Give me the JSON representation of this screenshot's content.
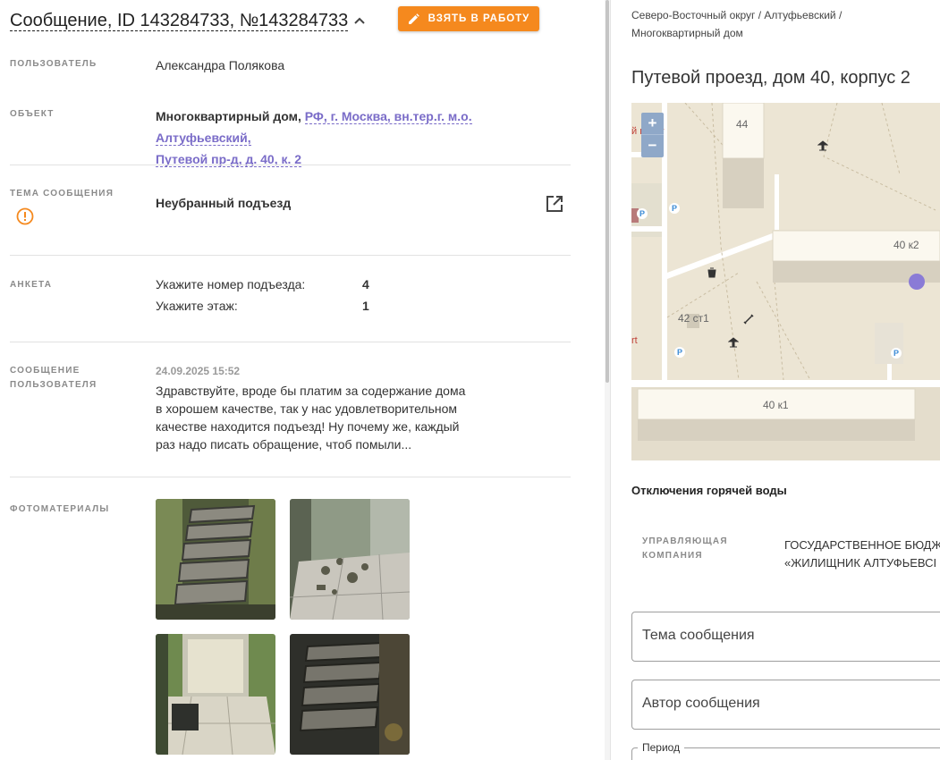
{
  "header": {
    "title": "Сообщение, ID 143284733, №143284733",
    "take_button": "ВЗЯТЬ В РАБОТУ"
  },
  "fields": {
    "user_label": "ПОЛЬЗОВАТЕЛЬ",
    "user_value": "Александра Полякова",
    "object_label": "ОБЪЕКТ",
    "object_type": "Многоквартирный дом,",
    "object_link_1": "РФ, г. Москва, вн.тер.г. м.о. Алтуфьевский,",
    "object_link_2": "Путевой пр-д, д. 40, к. 2",
    "topic_label": "ТЕМА СООБЩЕНИЯ",
    "topic_value": "Неубранный подъезд",
    "survey_label": "АНКЕТА",
    "survey": [
      {
        "question": "Укажите номер подъезда:",
        "answer": "4"
      },
      {
        "question": "Укажите этаж:",
        "answer": "1"
      }
    ],
    "message_label_1": "СООБЩЕНИЕ",
    "message_label_2": "ПОЛЬЗОВАТЕЛЯ",
    "message_date": "24.09.2025 15:52",
    "message_text": "Здравствуйте, вроде бы платим за содержание дома в хорошем качестве, так у нас удовлетворительном качестве находится подъезд! Ну почему же, каждый раз надо писать обращение, чтоб помыли...",
    "photos_label": "ФОТОМАТЕРИАЛЫ"
  },
  "right": {
    "breadcrumb": "Северо-Восточный округ / Алтуфьевский / Многоквартирный дом",
    "address": "Путевой проезд, дом 40, корпус 2",
    "map": {
      "zoom_in": "+",
      "zoom_out": "−",
      "label_44": "44",
      "label_40k2": "40 к2",
      "label_42": "42 ст1",
      "label_40k1": "40 к1",
      "label_punkt": "й пункт",
      "label_rt": "rt",
      "parking": "P"
    },
    "hot_water_title": "Отключения горячей воды",
    "mgmt_label_1": "УПРАВЛЯЮЩАЯ",
    "mgmt_label_2": "КОМПАНИЯ",
    "mgmt_value_1": "ГОСУДАРСТВЕННОЕ БЮДЖ",
    "mgmt_value_2": "«ЖИЛИЩНИК АЛТУФЬЕВСІ",
    "topic_field": "Тема сообщения",
    "author_field": "Автор сообщения",
    "period_legend": "Период"
  },
  "colors": {
    "accent_orange": "#f5891e",
    "link_purple": "#7a6cc8",
    "map_marker": "#8a7bd6"
  }
}
